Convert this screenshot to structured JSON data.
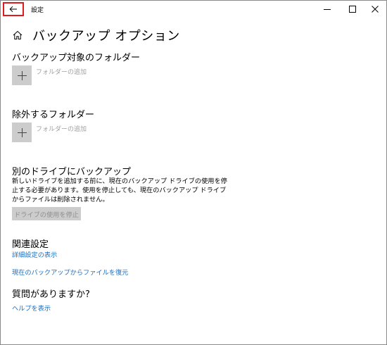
{
  "window": {
    "title": "設定"
  },
  "page": {
    "title": "バックアップ オプション"
  },
  "sections": {
    "backup_folders": {
      "title": "バックアップ対象のフォルダー",
      "add_label": "フォルダーの追加"
    },
    "exclude_folders": {
      "title": "除外するフォルダー",
      "add_label": "フォルダーの追加"
    },
    "other_drive": {
      "title": "別のドライブにバックアップ",
      "description": "新しいドライブを追加する前に、現在のバックアップ ドライブの使用を停止する必要があります。使用を停止しても、現在のバックアップ ドライブからファイルは削除されません。",
      "stop_button": "ドライブの使用を停止"
    },
    "related": {
      "title": "関連設定",
      "links": [
        "詳細設定の表示",
        "現在のバックアップからファイルを復元"
      ]
    },
    "help": {
      "title": "質問がありますか?",
      "link": "ヘルプを表示"
    }
  },
  "colors": {
    "highlight_border": "#e01b1b",
    "link": "#1a6fc2",
    "tile_bg": "#cccccc",
    "disabled_text": "#8f8f8f"
  },
  "icons": [
    "back-arrow-icon",
    "minimize-icon",
    "maximize-icon",
    "close-icon",
    "home-icon",
    "plus-icon"
  ]
}
